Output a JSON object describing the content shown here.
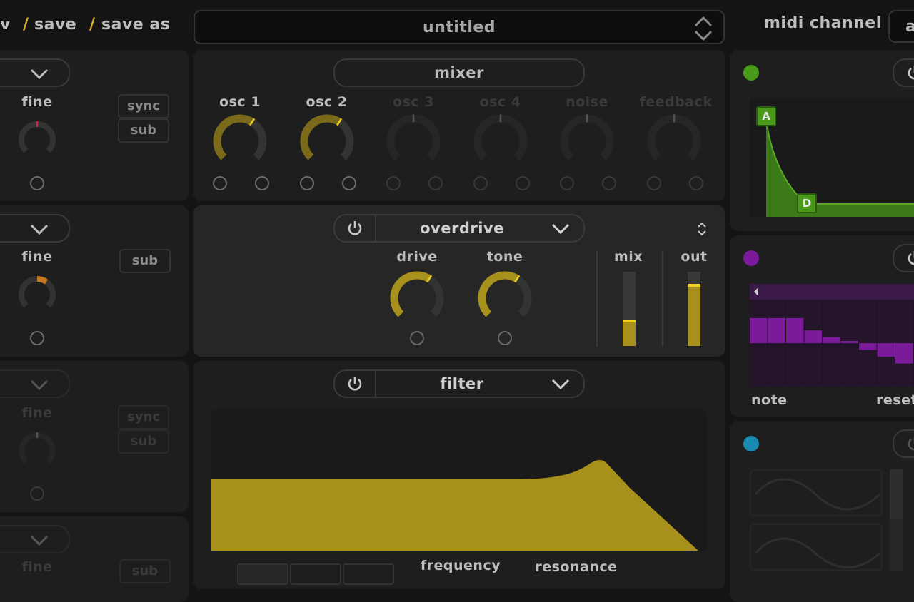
{
  "header": {
    "menu_partial": "v",
    "save_label": "save",
    "save_as_label": "save as",
    "preset_name": "untitled",
    "midi_channel_label": "midi channel",
    "midi_channel_value_partial": "a"
  },
  "osc_panels": [
    {
      "fine_label": "fine",
      "sync_label": "sync",
      "sub_label": "sub",
      "fine_value": 0.5,
      "active": true
    },
    {
      "fine_label": "fine",
      "sub_label": "sub",
      "fine_value": 0.62,
      "active": true
    },
    {
      "fine_label": "fine",
      "sync_label": "sync",
      "sub_label": "sub",
      "fine_value": 0.5,
      "active": false
    },
    {
      "fine_label": "fine",
      "sub_label": "sub",
      "active": false
    }
  ],
  "mixer": {
    "title": "mixer",
    "channels": [
      {
        "label": "osc 1",
        "value": 0.62,
        "active": true
      },
      {
        "label": "osc 2",
        "value": 0.62,
        "active": true
      },
      {
        "label": "osc 3",
        "value": 0.5,
        "active": false
      },
      {
        "label": "osc 4",
        "value": 0.5,
        "active": false
      },
      {
        "label": "noise",
        "value": 0.5,
        "active": false
      },
      {
        "label": "feedback",
        "value": 0.5,
        "active": false
      }
    ]
  },
  "effect": {
    "name": "overdrive",
    "knobs": [
      {
        "label": "drive",
        "value": 0.62
      },
      {
        "label": "tone",
        "value": 0.62
      }
    ],
    "mix_label": "mix",
    "mix_value": 0.36,
    "out_label": "out",
    "out_value": 0.84
  },
  "filter": {
    "name": "filter",
    "frequency_label": "frequency",
    "resonance_label": "resonance"
  },
  "envelope": {
    "attack_label": "A",
    "decay_label": "D",
    "color": "#4a8a1c"
  },
  "sequencer": {
    "note_label": "note",
    "reset_label": "reset",
    "color": "#7a1a9a",
    "steps": [
      0.55,
      0.55,
      0.55,
      0.28,
      0.13,
      0.02,
      -0.15,
      -0.3,
      -0.45
    ]
  },
  "lfo": {
    "color": "#1a8ab0"
  },
  "colors": {
    "accent": "#d9b12a",
    "gold_fill": "#a8901c",
    "knob_track": "#333333"
  }
}
